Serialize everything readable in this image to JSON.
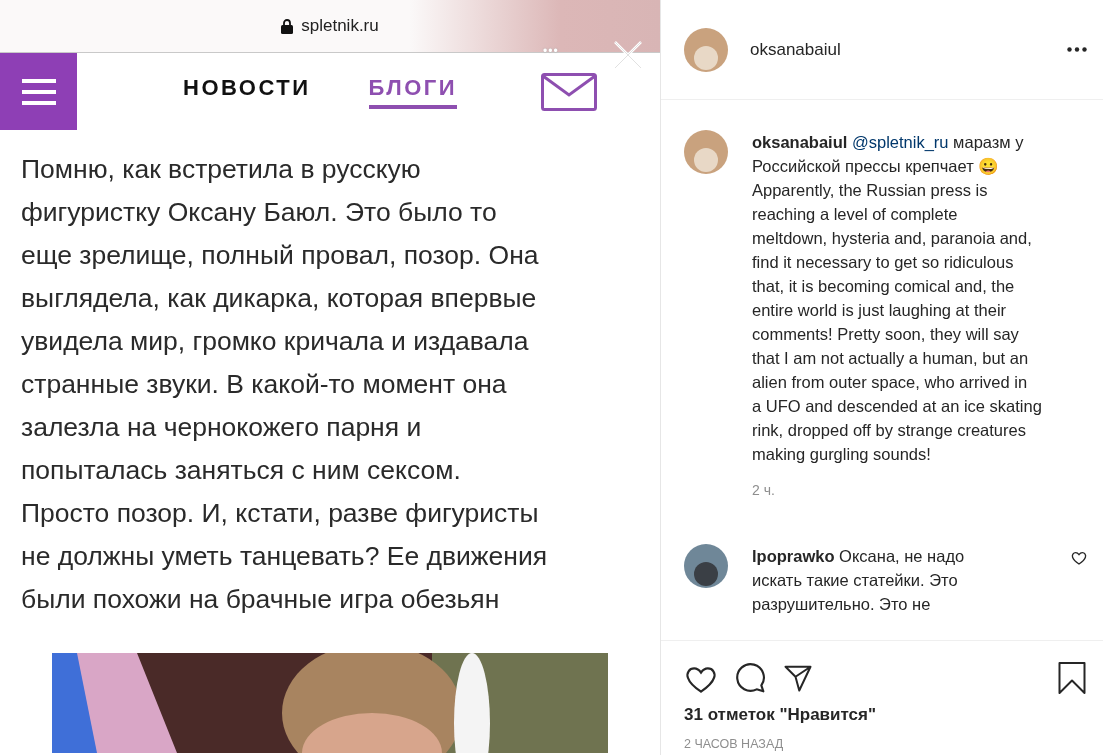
{
  "post_image": {
    "browser_bar": {
      "url": "spletnik.ru",
      "more": "•••"
    },
    "nav": {
      "items": [
        {
          "label": "НОВОСТИ",
          "selected": false
        },
        {
          "label": "БЛОГИ",
          "selected": true
        }
      ]
    },
    "article_text": "Помню, как встретила в русскую\nфигуристку Оксану Баюл. Это было то\nеще зрелище, полный провал, позор. Она\nвыглядела, как дикарка, которая впервые\nувидела мир, громко кричала и издавала\nстранные звуки. В какой-то момент она\nзалезла на чернокожего парня и\nпопыталась заняться с ним сексом.\nПросто позор. И, кстати, разве фигуристы\nне должны уметь танцевать? Ее движения\nбыли похожи на брачные игра обезьян"
  },
  "header": {
    "username": "oksanabaiul"
  },
  "caption": {
    "username": "oksanabaiul",
    "mention": "@spletnik_ru",
    "text": "маразм у\nРоссийской прессы крепчает 😀\nApparently, the Russian press is\nreaching a level of complete\nmeltdown, hysteria and, paranoia and,\nfind it necessary to get so ridiculous\nthat, it is becoming comical and, the\nentire world is just laughing at their\ncomments! Pretty soon, they will say\nthat I am not actually a human, but an\nalien from outer space, who arrived in\na UFO and descended at an ice skating\nrink, dropped off by strange creatures\nmaking gurgling sounds!",
    "time": "2 ч."
  },
  "comments": [
    {
      "username": "lpoprawko",
      "text": "Оксана, не надо\nискать такие статейки. Это\nразрушительно. Это не",
      "liked": false
    }
  ],
  "likes": "31 отметок \"Нравится\"",
  "posted": "2 ЧАСОВ НАЗАД"
}
